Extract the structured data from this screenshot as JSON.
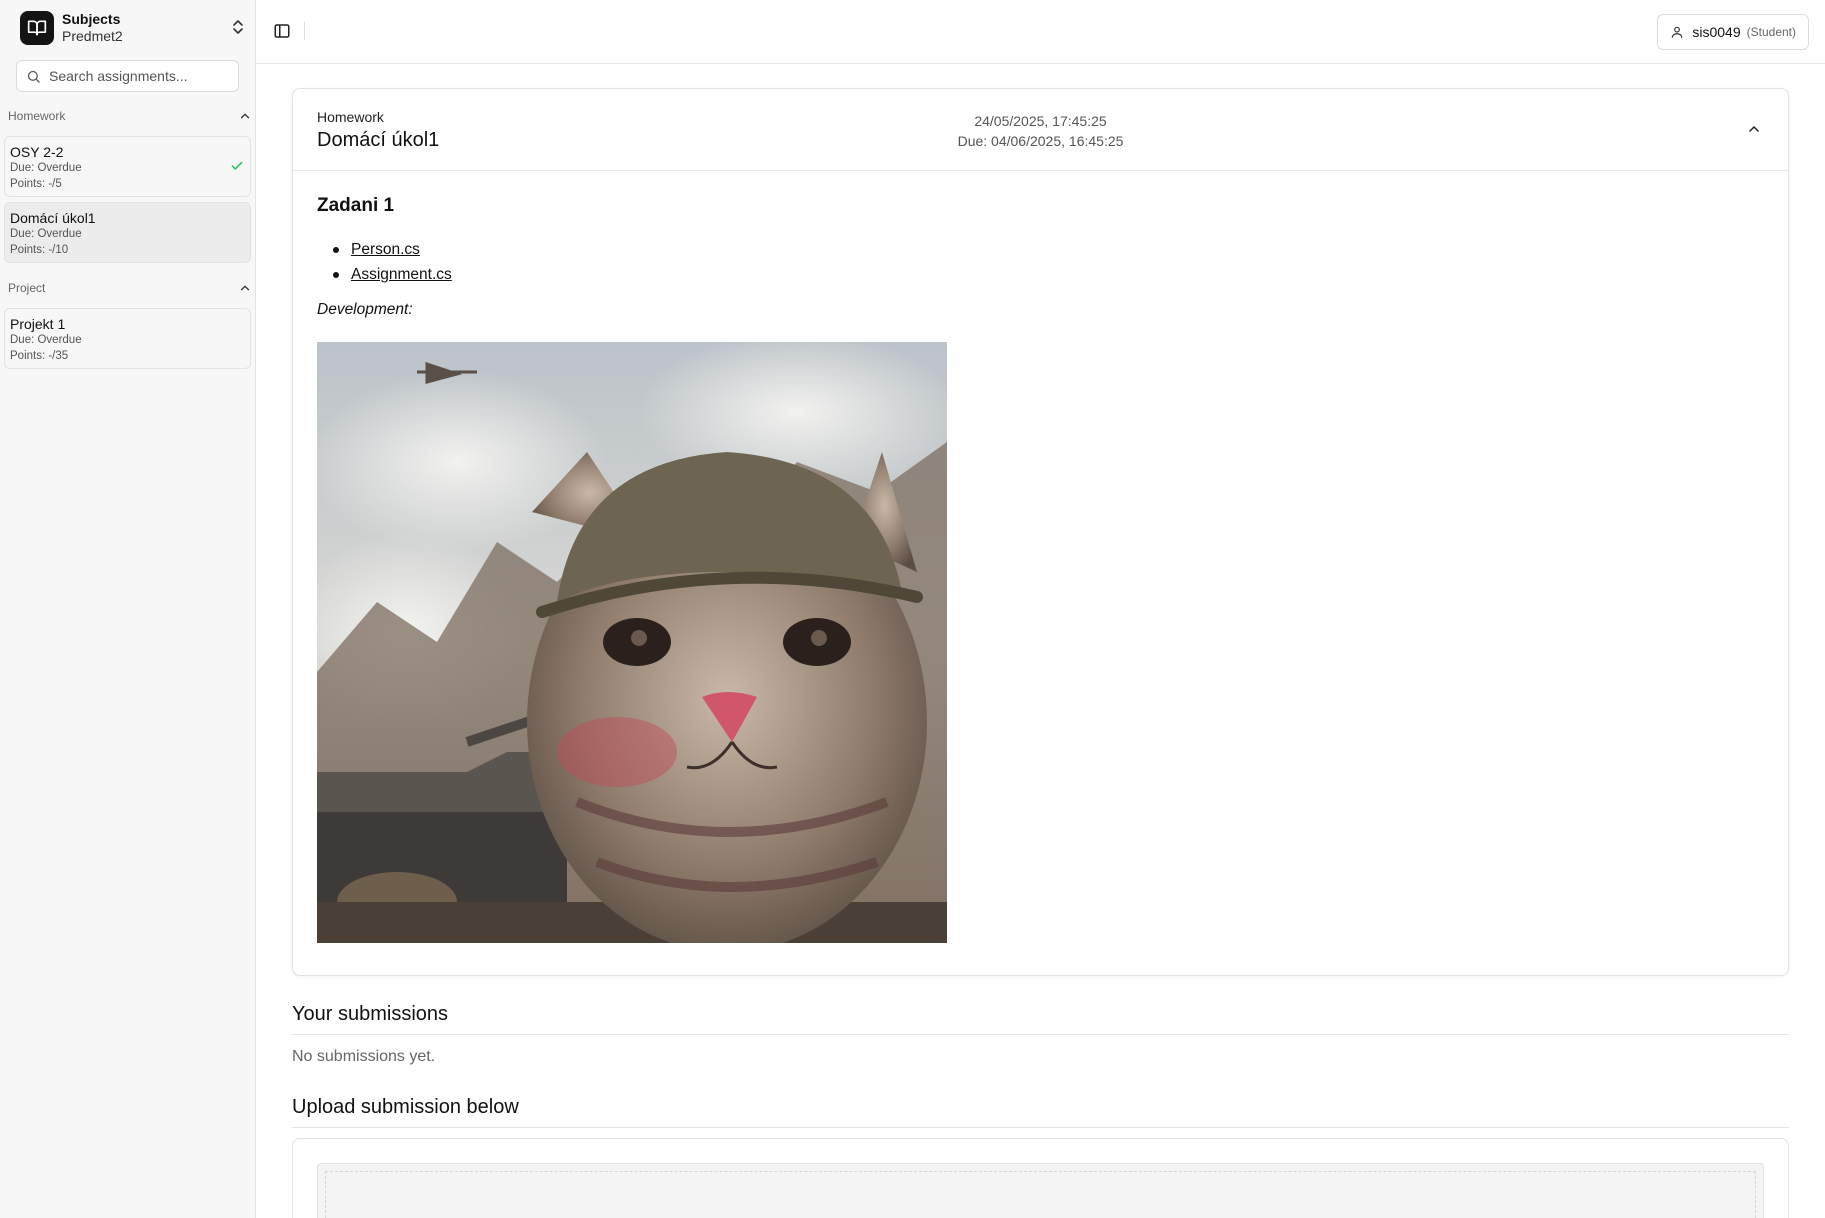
{
  "sidebar": {
    "switcher": {
      "title": "Subjects",
      "subtitle": "Predmet2"
    },
    "search": {
      "placeholder": "Search assignments..."
    },
    "groups": [
      {
        "label": "Homework",
        "items": [
          {
            "title": "OSY 2-2",
            "due": "Due: Overdue",
            "points": "Points: -/5",
            "completed": true
          },
          {
            "title": "Domácí úkol1",
            "due": "Due: Overdue",
            "points": "Points: -/10",
            "selected": true
          }
        ]
      },
      {
        "label": "Project",
        "items": [
          {
            "title": "Projekt 1",
            "due": "Due: Overdue",
            "points": "Points: -/35"
          }
        ]
      }
    ]
  },
  "topbar": {
    "user": {
      "name": "sis0049",
      "role": "(Student)"
    }
  },
  "assignment": {
    "type": "Homework",
    "title": "Domácí úkol1",
    "created": "24/05/2025, 17:45:25",
    "due": "Due: 04/06/2025, 16:45:25",
    "body": {
      "heading": "Zadani 1",
      "files": [
        "Person.cs",
        "Assignment.cs"
      ],
      "note": "Development:"
    }
  },
  "submissions": {
    "title": "Your submissions",
    "empty_text": "No submissions yet."
  },
  "upload": {
    "title": "Upload submission below"
  },
  "colors": {
    "accent": "#141414",
    "success": "#22c55e",
    "sidebar_bg": "#f7f7f7"
  }
}
